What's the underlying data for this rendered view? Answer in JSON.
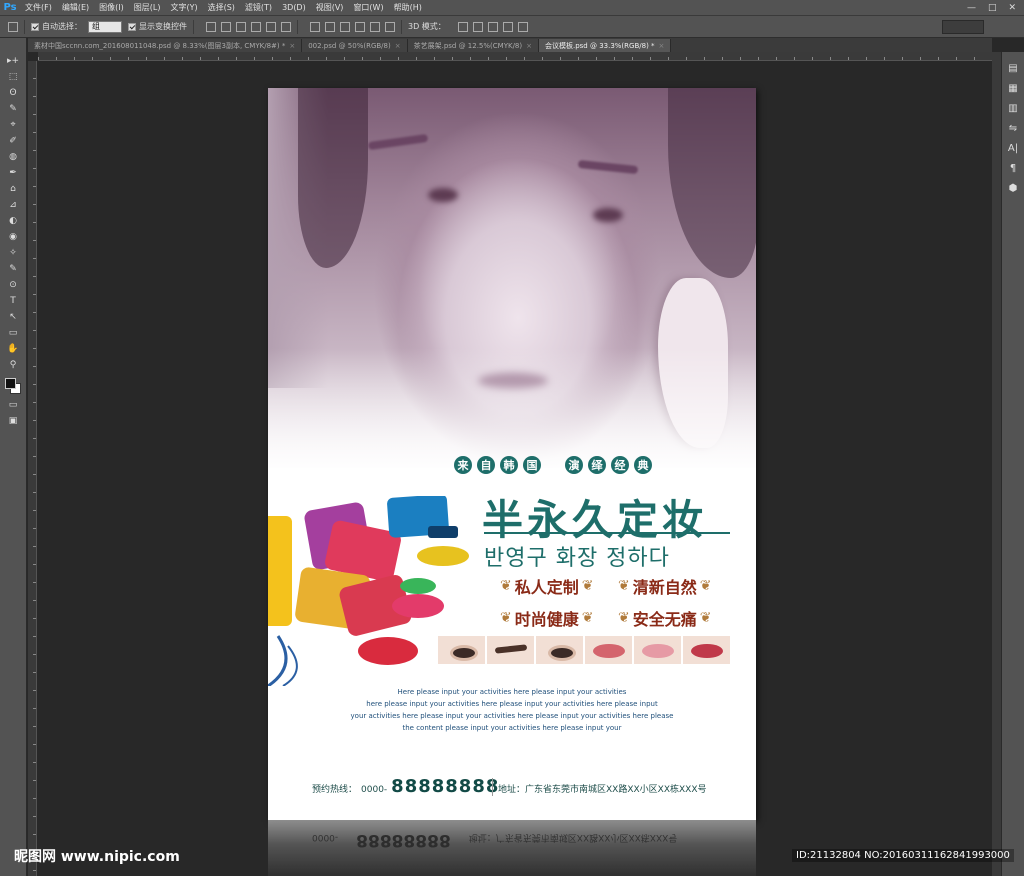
{
  "app": {
    "logo": "Ps"
  },
  "menu": [
    "文件(F)",
    "编辑(E)",
    "图像(I)",
    "图层(L)",
    "文字(Y)",
    "选择(S)",
    "滤镜(T)",
    "3D(D)",
    "视图(V)",
    "窗口(W)",
    "帮助(H)"
  ],
  "window_controls": {
    "minimize": "—",
    "maximize": "□",
    "close": "✕"
  },
  "options": {
    "auto_select_label": "自动选择：",
    "auto_select_value": "组",
    "show_transform_label": "显示变换控件",
    "mode_3d_label": "3D 模式："
  },
  "tabs": [
    {
      "label": "素材中国sccnn.com_201608011048.psd @ 8.33%(图层3副本, CMYK/8#) *",
      "active": false
    },
    {
      "label": "002.psd @ 50%(RGB/8)",
      "active": false
    },
    {
      "label": "茶艺展架.psd @ 12.5%(CMYK/8)",
      "active": false
    },
    {
      "label": "会议模板.psd @ 33.3%(RGB/8) *",
      "active": true
    }
  ],
  "tab_close": "×",
  "tools": [
    "▸+",
    "⬚",
    "ʘ",
    "✎",
    "⌖",
    "✐",
    "◍",
    "✒",
    "⌂",
    "⊿",
    "◐",
    "◉",
    "✧",
    "✎",
    "⊙",
    "T",
    "↖",
    "▭",
    "✋",
    "⚲"
  ],
  "right_panel_icons": [
    "▤",
    "▦",
    "▥",
    "⇋",
    "A|",
    "¶",
    "⬢"
  ],
  "poster": {
    "tagline_a": [
      "来",
      "自",
      "韩",
      "国"
    ],
    "tagline_b": [
      "演",
      "绎",
      "经",
      "典"
    ],
    "title": "半永久定妆",
    "korean": "반영구 화장 정하다",
    "features": [
      "私人定制",
      "清新自然",
      "时尚健康",
      "安全无痛"
    ],
    "laurel_left": "❦",
    "laurel_right": "❦",
    "body_lines": [
      "Here please input your activities here please input your activities",
      "here please input your activities here please input your activities here please input",
      "your activities here please input your activities here please input your activities here please",
      "the content please input your activities here please input your"
    ],
    "hotline_label": "预约热线：",
    "hotline_prefix": "0000-",
    "hotline_number": "88888888",
    "address": "地址：广东省东莞市南城区XX路XX小区XX栋XXX号"
  },
  "watermark": {
    "site": "昵图网 www.nipic.com",
    "id": "ID:21132804 NO:20160311162841993000"
  }
}
